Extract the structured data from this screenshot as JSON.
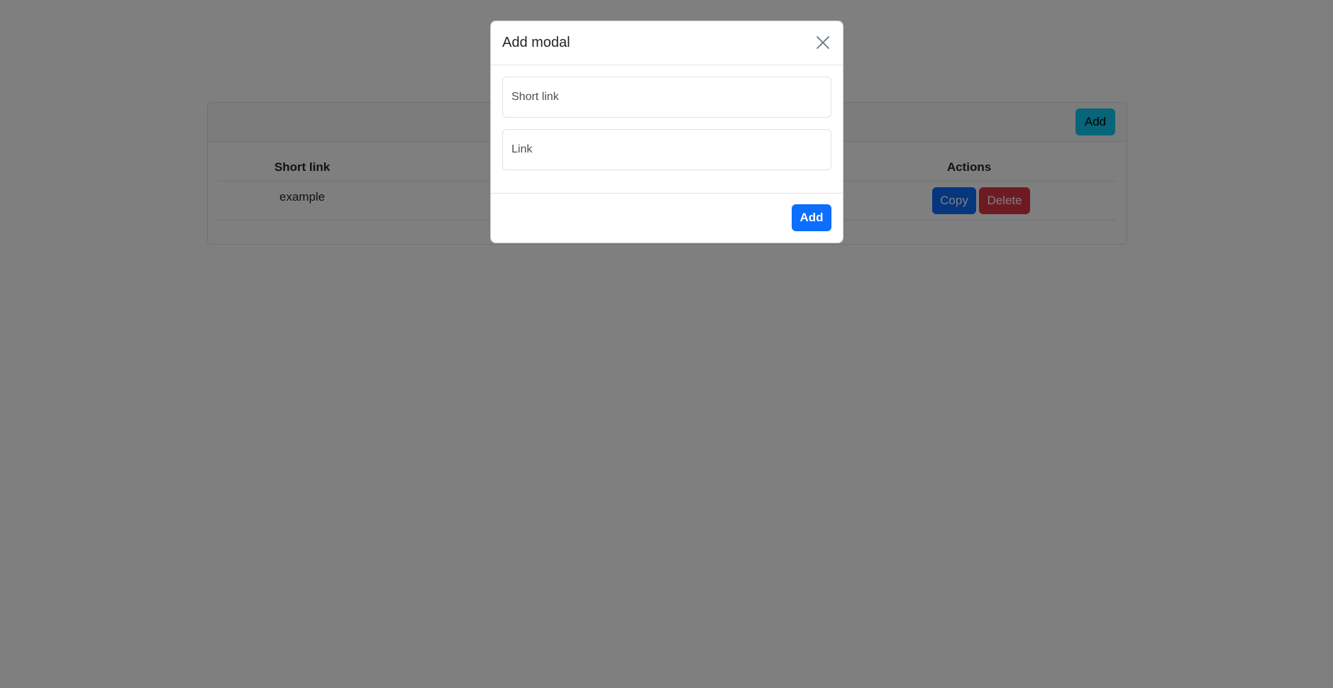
{
  "card": {
    "header_add_label": "Add",
    "table": {
      "headers": {
        "short_link": "Short link",
        "actions": "Actions"
      },
      "rows": [
        {
          "short_link": "example",
          "copy_label": "Copy",
          "delete_label": "Delete"
        }
      ]
    }
  },
  "modal": {
    "title": "Add modal",
    "close_icon": "close-icon",
    "short_link_placeholder": "Short link",
    "link_placeholder": "Link",
    "add_label": "Add"
  },
  "colors": {
    "primary": "#0d6efd",
    "info": "#0dcaf0",
    "danger": "#dc3545",
    "backdrop": "rgba(0,0,0,0.5)"
  }
}
